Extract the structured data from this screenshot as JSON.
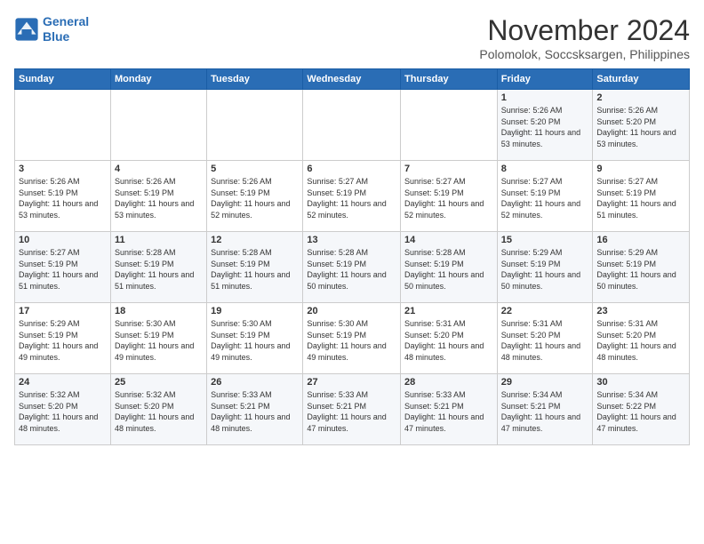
{
  "logo": {
    "line1": "General",
    "line2": "Blue"
  },
  "title": "November 2024",
  "location": "Polomolok, Soccsksargen, Philippines",
  "weekdays": [
    "Sunday",
    "Monday",
    "Tuesday",
    "Wednesday",
    "Thursday",
    "Friday",
    "Saturday"
  ],
  "weeks": [
    [
      {
        "day": "",
        "sunrise": "",
        "sunset": "",
        "daylight": ""
      },
      {
        "day": "",
        "sunrise": "",
        "sunset": "",
        "daylight": ""
      },
      {
        "day": "",
        "sunrise": "",
        "sunset": "",
        "daylight": ""
      },
      {
        "day": "",
        "sunrise": "",
        "sunset": "",
        "daylight": ""
      },
      {
        "day": "",
        "sunrise": "",
        "sunset": "",
        "daylight": ""
      },
      {
        "day": "1",
        "sunrise": "Sunrise: 5:26 AM",
        "sunset": "Sunset: 5:20 PM",
        "daylight": "Daylight: 11 hours and 53 minutes."
      },
      {
        "day": "2",
        "sunrise": "Sunrise: 5:26 AM",
        "sunset": "Sunset: 5:20 PM",
        "daylight": "Daylight: 11 hours and 53 minutes."
      }
    ],
    [
      {
        "day": "3",
        "sunrise": "Sunrise: 5:26 AM",
        "sunset": "Sunset: 5:19 PM",
        "daylight": "Daylight: 11 hours and 53 minutes."
      },
      {
        "day": "4",
        "sunrise": "Sunrise: 5:26 AM",
        "sunset": "Sunset: 5:19 PM",
        "daylight": "Daylight: 11 hours and 53 minutes."
      },
      {
        "day": "5",
        "sunrise": "Sunrise: 5:26 AM",
        "sunset": "Sunset: 5:19 PM",
        "daylight": "Daylight: 11 hours and 52 minutes."
      },
      {
        "day": "6",
        "sunrise": "Sunrise: 5:27 AM",
        "sunset": "Sunset: 5:19 PM",
        "daylight": "Daylight: 11 hours and 52 minutes."
      },
      {
        "day": "7",
        "sunrise": "Sunrise: 5:27 AM",
        "sunset": "Sunset: 5:19 PM",
        "daylight": "Daylight: 11 hours and 52 minutes."
      },
      {
        "day": "8",
        "sunrise": "Sunrise: 5:27 AM",
        "sunset": "Sunset: 5:19 PM",
        "daylight": "Daylight: 11 hours and 52 minutes."
      },
      {
        "day": "9",
        "sunrise": "Sunrise: 5:27 AM",
        "sunset": "Sunset: 5:19 PM",
        "daylight": "Daylight: 11 hours and 51 minutes."
      }
    ],
    [
      {
        "day": "10",
        "sunrise": "Sunrise: 5:27 AM",
        "sunset": "Sunset: 5:19 PM",
        "daylight": "Daylight: 11 hours and 51 minutes."
      },
      {
        "day": "11",
        "sunrise": "Sunrise: 5:28 AM",
        "sunset": "Sunset: 5:19 PM",
        "daylight": "Daylight: 11 hours and 51 minutes."
      },
      {
        "day": "12",
        "sunrise": "Sunrise: 5:28 AM",
        "sunset": "Sunset: 5:19 PM",
        "daylight": "Daylight: 11 hours and 51 minutes."
      },
      {
        "day": "13",
        "sunrise": "Sunrise: 5:28 AM",
        "sunset": "Sunset: 5:19 PM",
        "daylight": "Daylight: 11 hours and 50 minutes."
      },
      {
        "day": "14",
        "sunrise": "Sunrise: 5:28 AM",
        "sunset": "Sunset: 5:19 PM",
        "daylight": "Daylight: 11 hours and 50 minutes."
      },
      {
        "day": "15",
        "sunrise": "Sunrise: 5:29 AM",
        "sunset": "Sunset: 5:19 PM",
        "daylight": "Daylight: 11 hours and 50 minutes."
      },
      {
        "day": "16",
        "sunrise": "Sunrise: 5:29 AM",
        "sunset": "Sunset: 5:19 PM",
        "daylight": "Daylight: 11 hours and 50 minutes."
      }
    ],
    [
      {
        "day": "17",
        "sunrise": "Sunrise: 5:29 AM",
        "sunset": "Sunset: 5:19 PM",
        "daylight": "Daylight: 11 hours and 49 minutes."
      },
      {
        "day": "18",
        "sunrise": "Sunrise: 5:30 AM",
        "sunset": "Sunset: 5:19 PM",
        "daylight": "Daylight: 11 hours and 49 minutes."
      },
      {
        "day": "19",
        "sunrise": "Sunrise: 5:30 AM",
        "sunset": "Sunset: 5:19 PM",
        "daylight": "Daylight: 11 hours and 49 minutes."
      },
      {
        "day": "20",
        "sunrise": "Sunrise: 5:30 AM",
        "sunset": "Sunset: 5:19 PM",
        "daylight": "Daylight: 11 hours and 49 minutes."
      },
      {
        "day": "21",
        "sunrise": "Sunrise: 5:31 AM",
        "sunset": "Sunset: 5:20 PM",
        "daylight": "Daylight: 11 hours and 48 minutes."
      },
      {
        "day": "22",
        "sunrise": "Sunrise: 5:31 AM",
        "sunset": "Sunset: 5:20 PM",
        "daylight": "Daylight: 11 hours and 48 minutes."
      },
      {
        "day": "23",
        "sunrise": "Sunrise: 5:31 AM",
        "sunset": "Sunset: 5:20 PM",
        "daylight": "Daylight: 11 hours and 48 minutes."
      }
    ],
    [
      {
        "day": "24",
        "sunrise": "Sunrise: 5:32 AM",
        "sunset": "Sunset: 5:20 PM",
        "daylight": "Daylight: 11 hours and 48 minutes."
      },
      {
        "day": "25",
        "sunrise": "Sunrise: 5:32 AM",
        "sunset": "Sunset: 5:20 PM",
        "daylight": "Daylight: 11 hours and 48 minutes."
      },
      {
        "day": "26",
        "sunrise": "Sunrise: 5:33 AM",
        "sunset": "Sunset: 5:21 PM",
        "daylight": "Daylight: 11 hours and 48 minutes."
      },
      {
        "day": "27",
        "sunrise": "Sunrise: 5:33 AM",
        "sunset": "Sunset: 5:21 PM",
        "daylight": "Daylight: 11 hours and 47 minutes."
      },
      {
        "day": "28",
        "sunrise": "Sunrise: 5:33 AM",
        "sunset": "Sunset: 5:21 PM",
        "daylight": "Daylight: 11 hours and 47 minutes."
      },
      {
        "day": "29",
        "sunrise": "Sunrise: 5:34 AM",
        "sunset": "Sunset: 5:21 PM",
        "daylight": "Daylight: 11 hours and 47 minutes."
      },
      {
        "day": "30",
        "sunrise": "Sunrise: 5:34 AM",
        "sunset": "Sunset: 5:22 PM",
        "daylight": "Daylight: 11 hours and 47 minutes."
      }
    ]
  ]
}
